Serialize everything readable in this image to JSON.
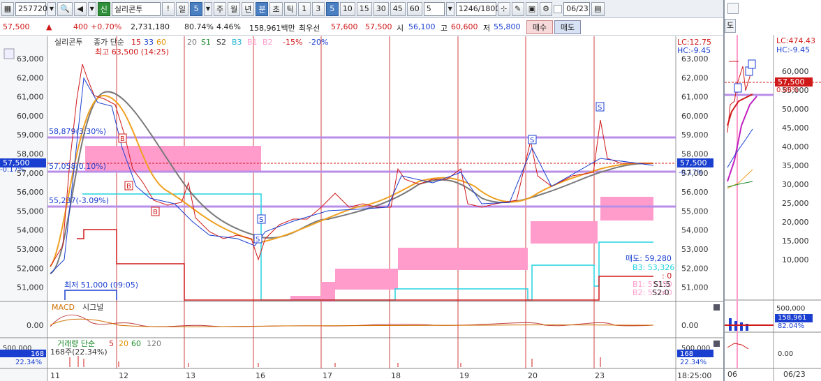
{
  "toolbar": {
    "code": "257720",
    "badge": "신",
    "name": "실리콘투",
    "excl": "!",
    "period_day": "일",
    "period_n": "5",
    "periods": [
      "주",
      "월",
      "년",
      "분",
      "초",
      "틱"
    ],
    "mins": [
      "1",
      "3",
      "5",
      "10",
      "15",
      "30",
      "45",
      "60"
    ],
    "count": "5",
    "range": "1246/1800",
    "date": "06/23"
  },
  "quote": {
    "price": "57,500",
    "arrow": "▲",
    "change": "400",
    "pct": "+0.70%",
    "volume": "2,731,180",
    "ratio": "80.74%",
    "turn": "4.46%",
    "amount": "158,961백만",
    "best_label": "최우선",
    "best_ask": "57,600",
    "best_bid": "57,500",
    "open_label": "시",
    "open": "56,100",
    "high_label": "고",
    "high": "60,600",
    "low_label": "저",
    "low": "55,800",
    "buy_btn": "매수",
    "sell_btn": "매도"
  },
  "legend": {
    "name": "실리콘투",
    "ma_label": "종가 단순",
    "ma": [
      "15",
      "33",
      "60",
      "20",
      "S1",
      "S2",
      "B3",
      "B1",
      "B2"
    ],
    "pcts": [
      "-15%",
      "-20%"
    ]
  },
  "annotations": {
    "high": "최고 63,500 (14:25)",
    "low": "최저 51,000 (09:05)",
    "lc": "LC:12.75",
    "hc": "HC:-9.45",
    "level1": "58,879(3.30%)",
    "level2": "57,058(0.10%)",
    "level3": "55,237(-3.09%)",
    "cur_price": "57,500",
    "cur_pct": "-0.17%",
    "sell_info": "매도: 59,280",
    "b3": "B3: 53,326",
    "zero": ": 0",
    "b1": "B1: 55150",
    "b2": "B2: 55240",
    "s1": "S1:5",
    "s2": "S2:0"
  },
  "yaxis": [
    "63,000",
    "62,000",
    "61,000",
    "60,000",
    "59,000",
    "58,000",
    "57,000",
    "56,000",
    "55,000",
    "54,000",
    "53,000",
    "52,000",
    "51,000"
  ],
  "macd": {
    "label": "MACD",
    "signal": "시그널",
    "zero": "0.00"
  },
  "volume": {
    "label": "거래량 단순",
    "ma": [
      "5",
      "20",
      "60",
      "120"
    ],
    "value": "168",
    "pct": "22.34%",
    "note": "168주(22.34%)",
    "ytick": "500,000"
  },
  "xaxis": [
    "11",
    "12",
    "13",
    "16",
    "17",
    "18",
    "19",
    "20",
    "23"
  ],
  "time": "18:25:00",
  "right": {
    "lc": "LC:474.43",
    "hc": "HC:-9.45",
    "yaxis": [
      "60,000",
      "55,000",
      "50,000",
      "45,000",
      "40,000",
      "35,000",
      "30,000",
      "25,000",
      "20,000",
      "15,000",
      "10,000"
    ],
    "price": "57,500",
    "pct": "0.88%",
    "btn": "도",
    "vol_tick": "500,000",
    "vol_value": "158,961",
    "vol_pct": "82.04%",
    "zero": "0.00",
    "date_left": "06",
    "date_right": "06/23"
  },
  "colors": {
    "red": "#d01818",
    "blue": "#1a3fd0",
    "pink": "#ff9ccc",
    "cyan": "#22d4e0",
    "purple": "#b98ee8",
    "accent": "#2a5fbf"
  }
}
